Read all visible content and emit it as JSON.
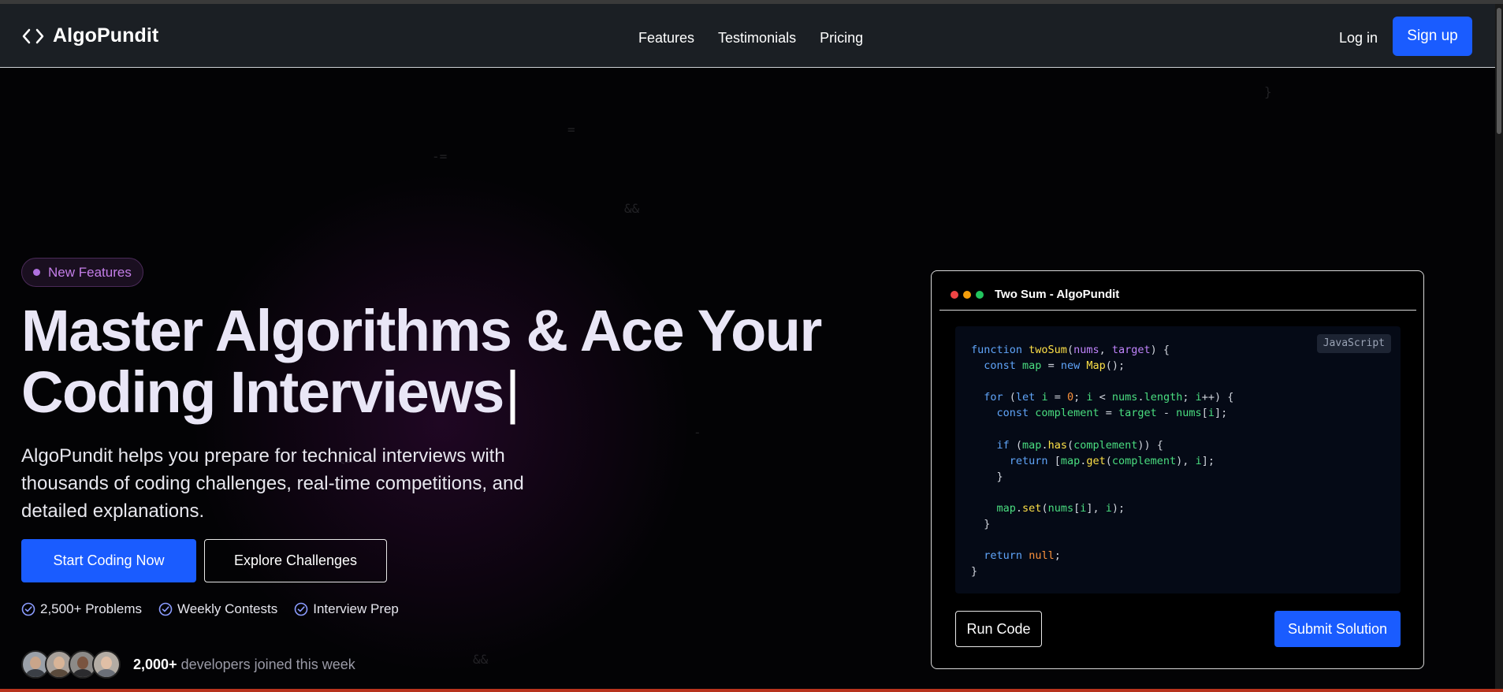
{
  "brand": {
    "name": "AlgoPundit",
    "icon": "code-brackets-icon"
  },
  "nav": {
    "links": [
      "Features",
      "Testimonials",
      "Pricing"
    ],
    "login": "Log in",
    "signup": "Sign up"
  },
  "hero": {
    "badge": "New Features",
    "headline_line1": "Master Algorithms & Ace Your",
    "headline_line2": "Coding Interviews",
    "caret": "|",
    "subtext": "AlgoPundit helps you prepare for technical interviews with thousands of coding challenges, real-time competitions, and detailed explanations.",
    "primary_cta": "Start Coding Now",
    "secondary_cta": "Explore Challenges",
    "features": [
      "2,500+ Problems",
      "Weekly Contests",
      "Interview Prep"
    ],
    "social_count": "2,000+",
    "social_text": "developers joined this week",
    "background_symbols": [
      "=",
      "-=",
      "&&",
      "<=",
      "-",
      "&&",
      "}"
    ]
  },
  "editor": {
    "title": "Two Sum - AlgoPundit",
    "language": "JavaScript",
    "code": [
      "function twoSum(nums, target) {",
      "  const map = new Map();",
      "",
      "  for (let i = 0; i < nums.length; i++) {",
      "    const complement = target - nums[i];",
      "",
      "    if (map.has(complement)) {",
      "      return [map.get(complement), i];",
      "    }",
      "",
      "    map.set(nums[i], i);",
      "  }",
      "",
      "  return null;",
      "}"
    ],
    "run_label": "Run Code",
    "submit_label": "Submit Solution"
  },
  "colors": {
    "accent": "#1a5cff",
    "badge": "#c47ee8",
    "navbar": "#1b1f24",
    "background": "#030305"
  }
}
